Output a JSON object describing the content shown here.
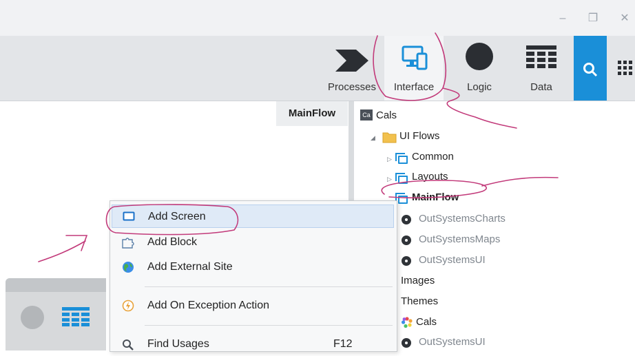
{
  "window_controls": {
    "minimize": "–",
    "restore": "❐",
    "close": "✕"
  },
  "tabs": [
    {
      "label": "Processes",
      "icon": "processes-chevron-icon"
    },
    {
      "label": "Interface",
      "icon": "interface-devices-icon",
      "active": true
    },
    {
      "label": "Logic",
      "icon": "logic-circle-icon"
    },
    {
      "label": "Data",
      "icon": "data-grid-icon"
    }
  ],
  "canvas": {
    "flow_tab": "MainFlow"
  },
  "tree": {
    "root": {
      "badge": "Ca",
      "label": "Cals"
    },
    "ui_flows": "UI Flows",
    "flows": [
      "Common",
      "Layouts",
      "MainFlow"
    ],
    "dependencies": [
      "OutSystemsCharts",
      "OutSystemsMaps",
      "OutSystemsUI"
    ],
    "images": "Images",
    "themes": "Themes",
    "theme_items": [
      "Cals",
      "OutSystemsUI"
    ]
  },
  "context_menu": {
    "items": [
      {
        "label": "Add Screen",
        "icon": "screen-icon",
        "highlighted": true
      },
      {
        "label": "Add Block",
        "icon": "puzzle-block-icon"
      },
      {
        "label": "Add External Site",
        "icon": "globe-icon"
      },
      {
        "label": "Add On Exception Action",
        "icon": "exception-bolt-icon"
      },
      {
        "label": "Find Usages",
        "icon": "magnifier-icon",
        "shortcut": "F12"
      }
    ]
  },
  "colors": {
    "accent": "#1a8fd8",
    "annotation_ink": "#c23a7a"
  }
}
